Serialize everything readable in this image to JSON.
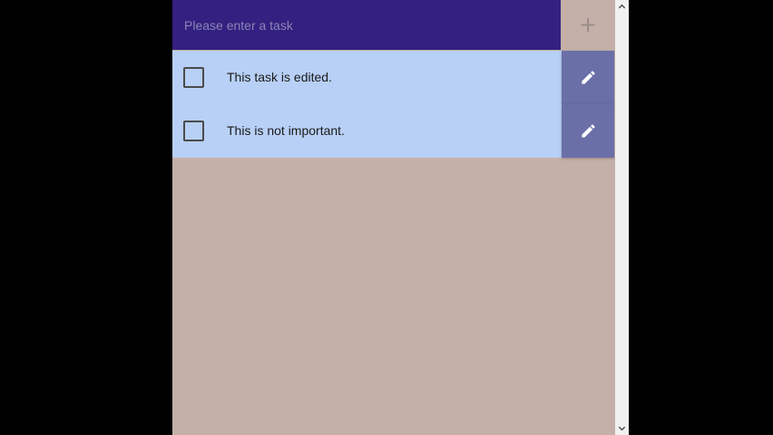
{
  "input": {
    "placeholder": "Please enter a task",
    "value": ""
  },
  "add_button": {
    "icon": "plus-icon",
    "label": "+"
  },
  "tasks": [
    {
      "text": "This task is edited.",
      "checked": false,
      "edit_icon": "pencil-icon"
    },
    {
      "text": "This is not important.",
      "checked": false,
      "edit_icon": "pencil-icon"
    }
  ],
  "colors": {
    "input_background": "#332080",
    "task_background": "#b8d0f6",
    "edit_button": "#6a6fa8",
    "app_background": "#c4b0a8"
  }
}
